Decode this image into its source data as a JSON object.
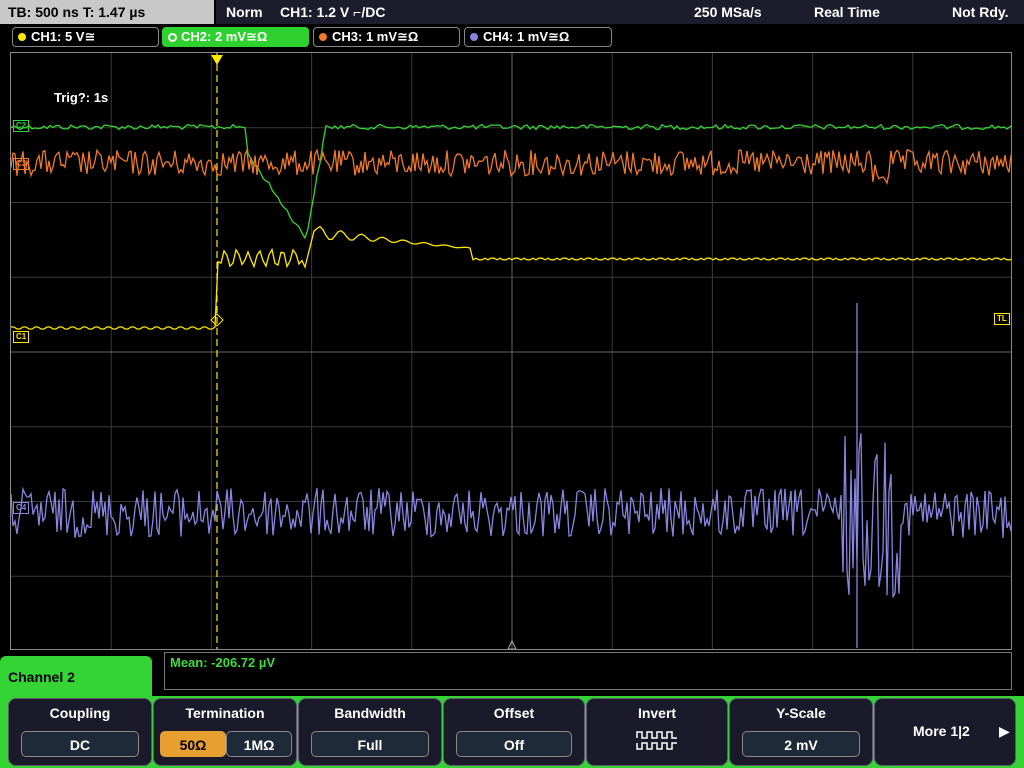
{
  "top": {
    "timebase": "TB: 500 ns   T: 1.47 µs",
    "mode": "Norm",
    "trigger": "CH1: 1.2 V ⌐/DC",
    "sample_rate": "250 MSa/s",
    "acq_mode": "Real Time",
    "status": "Not Rdy."
  },
  "channels": [
    {
      "label": "CH1: 5 V≅",
      "color": "#ffe800"
    },
    {
      "label": "CH2: 2 mV≅Ω",
      "color": "#33d433"
    },
    {
      "label": "CH3: 1 mV≅Ω",
      "color": "#f07a2a"
    },
    {
      "label": "CH4: 1 mV≅Ω",
      "color": "#8a85e0"
    }
  ],
  "scope": {
    "trig_text": "Trig?: 1s",
    "marker_c1": "C1",
    "marker_c2": "C2",
    "marker_c3": "C3",
    "marker_c4": "C4",
    "marker_tl": "TL"
  },
  "measurement": {
    "label": "Mean: -206.72 µV"
  },
  "menu": {
    "title": "Channel 2",
    "coupling": {
      "title": "Coupling",
      "value": "DC"
    },
    "termination": {
      "title": "Termination",
      "opt1": "50Ω",
      "opt2": "1MΩ"
    },
    "bandwidth": {
      "title": "Bandwidth",
      "value": "Full"
    },
    "offset": {
      "title": "Offset",
      "value": "Off"
    },
    "invert": {
      "title": "Invert"
    },
    "yscale": {
      "title": "Y-Scale",
      "value": "2 mV"
    },
    "more": {
      "label": "More 1|2"
    }
  }
}
